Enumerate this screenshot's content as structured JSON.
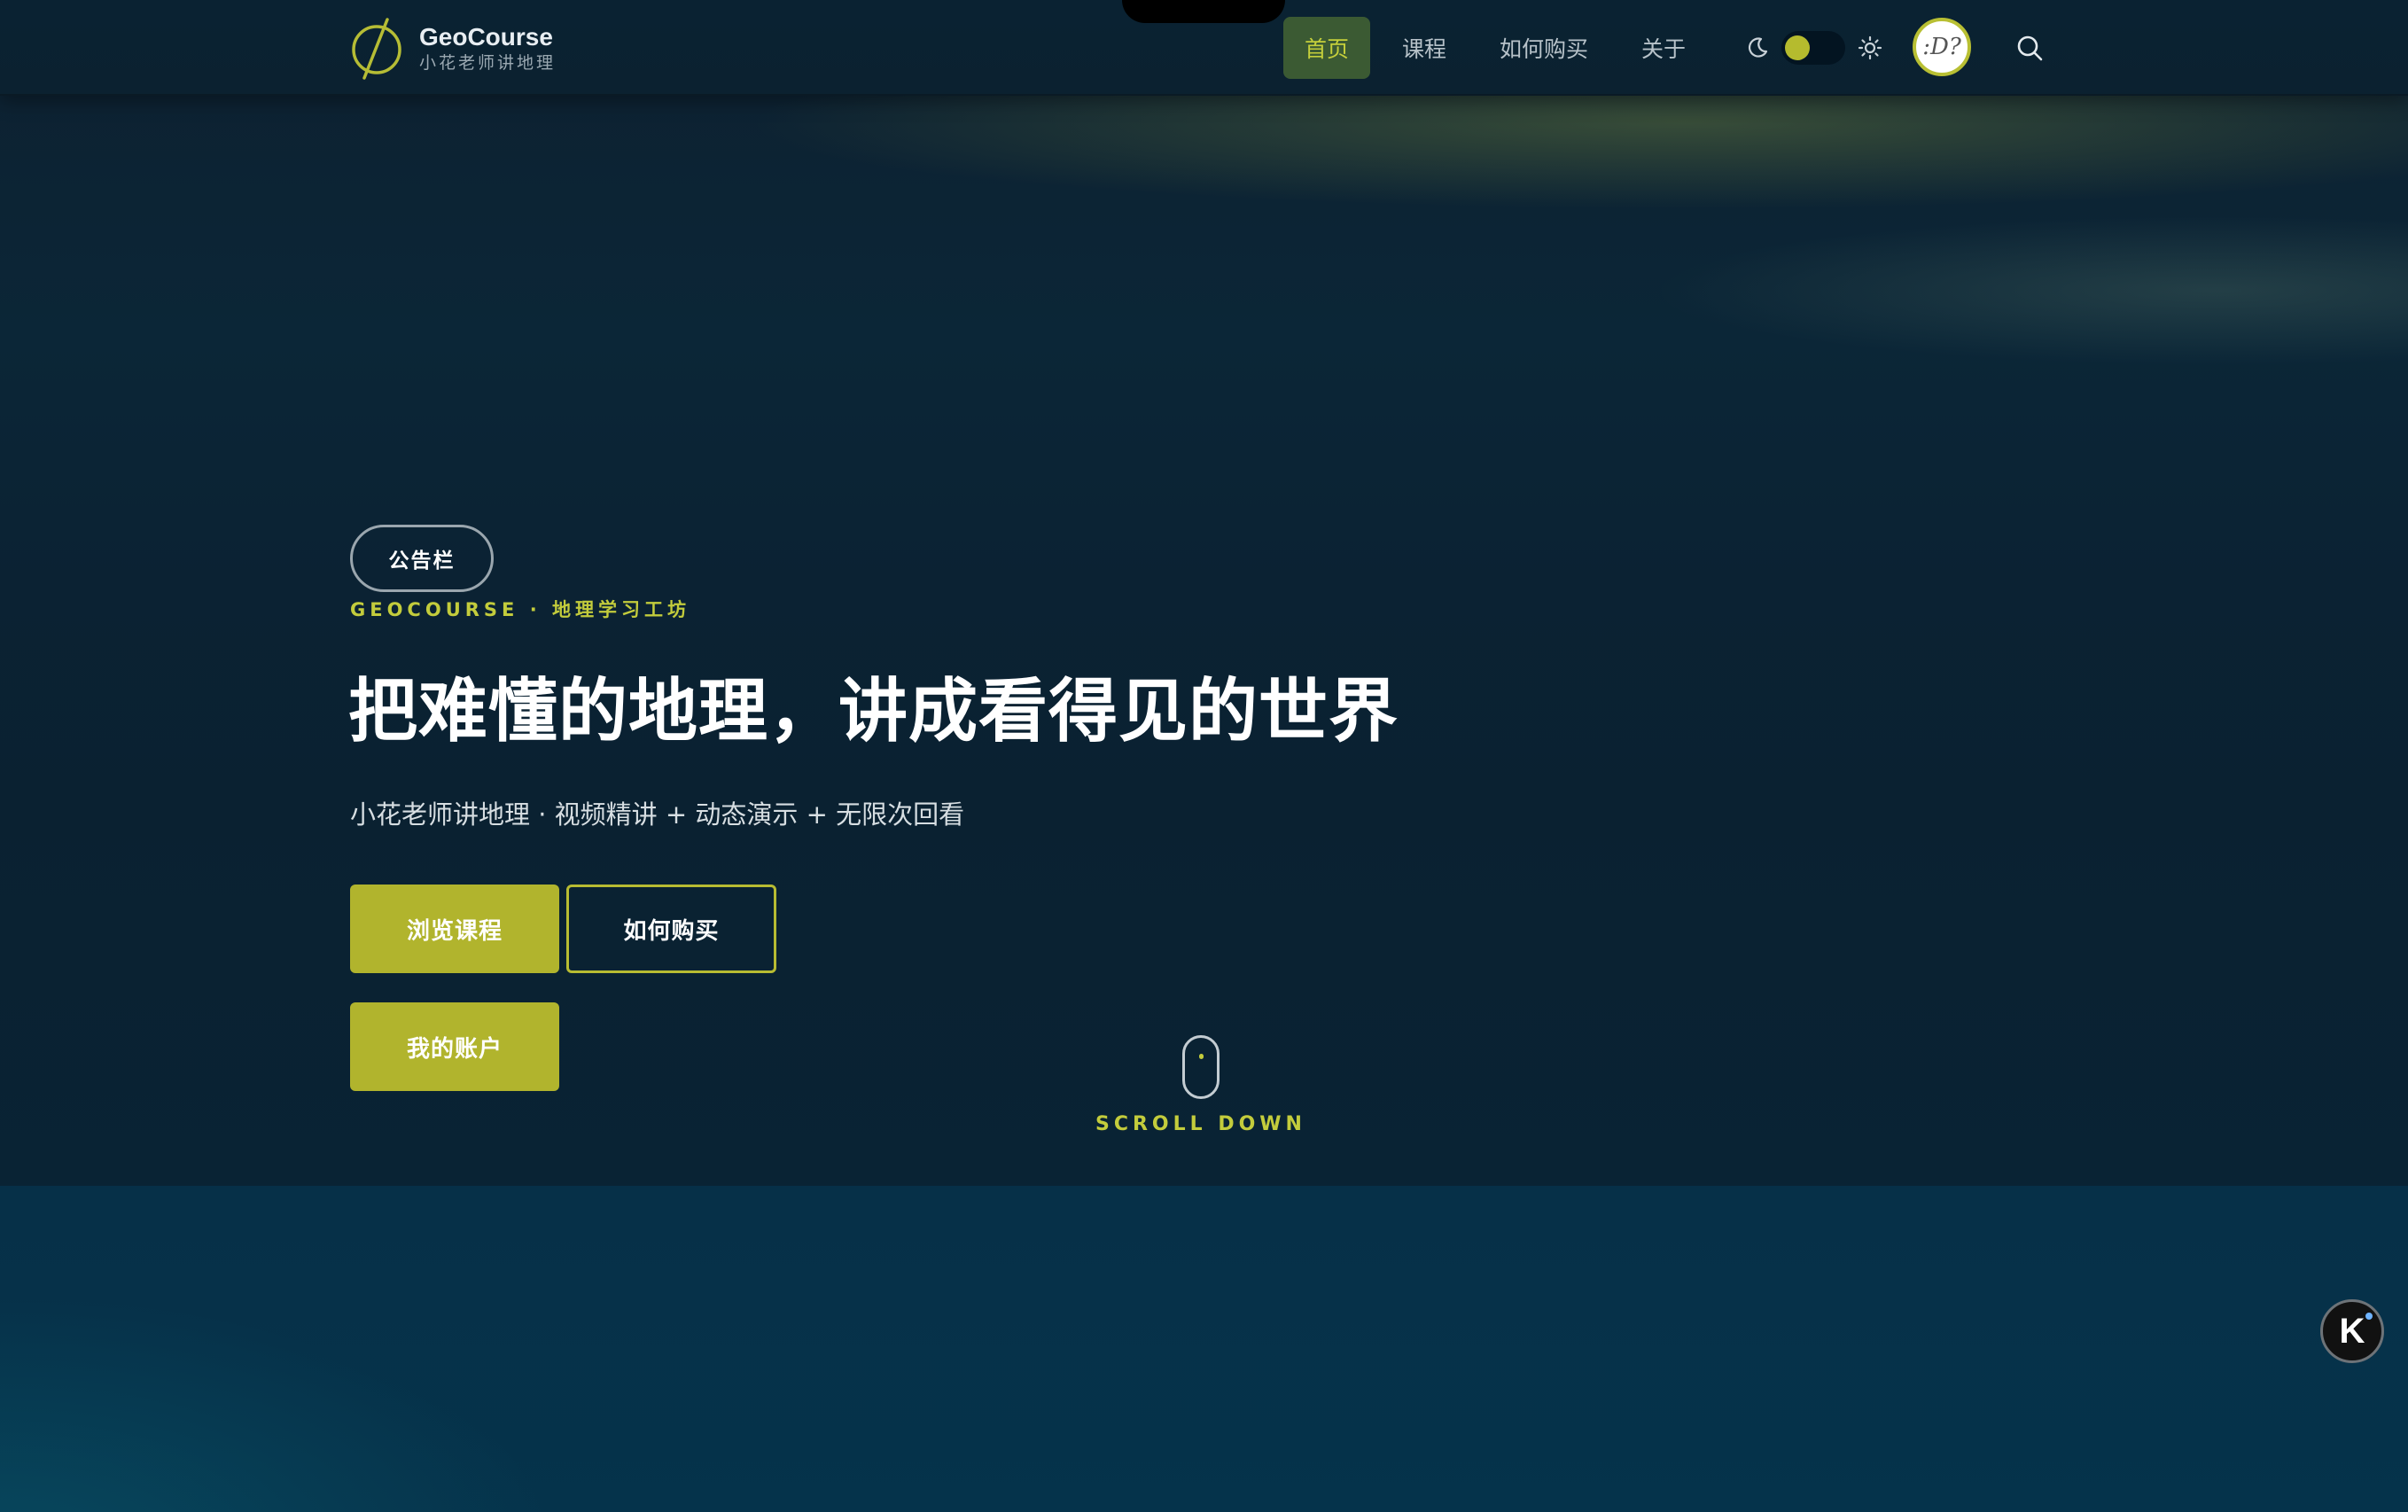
{
  "brand": {
    "title": "GeoCourse",
    "subtitle": "小花老师讲地理",
    "logo_icon": "slashed-circle-logo"
  },
  "nav": {
    "items": [
      {
        "label": "首页",
        "active": true
      },
      {
        "label": "课程",
        "active": false
      },
      {
        "label": "如何购买",
        "active": false
      },
      {
        "label": "关于",
        "active": false
      }
    ]
  },
  "header_tools": {
    "moon_icon": "moon-icon",
    "sun_icon": "sun-icon",
    "theme_mode": "dark",
    "avatar_text": ":D?",
    "search_icon": "search-icon"
  },
  "hero": {
    "badge": "公告栏",
    "eyebrow": "GEOCOURSE · 地理学习工坊",
    "headline": "把难懂的地理，讲成看得见的世界",
    "subline": "小花老师讲地理 · 视频精讲 + 动态演示 + 无限次回看",
    "buttons": {
      "browse": "浏览课程",
      "howto": "如何购买",
      "account": "我的账户"
    },
    "scroll_label": "SCROLL DOWN"
  },
  "widget": {
    "label": "K"
  },
  "colors": {
    "accent": "#b1b42d",
    "accent_text": "#c3cc3c",
    "nav_active_bg": "#3b5a33",
    "background": "#0b2233"
  }
}
